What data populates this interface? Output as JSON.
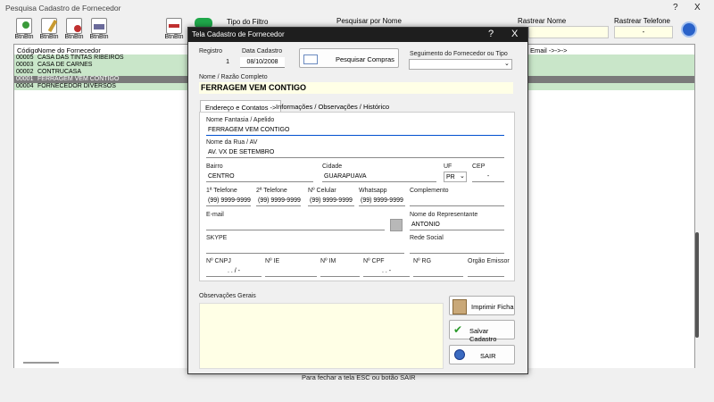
{
  "window": {
    "title": "Pesquisa Cadastro de Fornecedor",
    "help": "?",
    "close": "X"
  },
  "toolbar": {
    "buttons": [
      {
        "name": "new-button",
        "label": "BtnBtn",
        "color": "#3a9a3a"
      },
      {
        "name": "edit-button",
        "label": "BtnBtn",
        "color": "#c89a30"
      },
      {
        "name": "delete-button",
        "label": "BtnBtn",
        "color": "#c03030"
      },
      {
        "name": "print-button",
        "label": "BtnBtn",
        "color": "#6a6a9a"
      },
      {
        "name": "export-button",
        "label": "BtnBtn",
        "color": "#5a7ab0"
      }
    ],
    "filter_type_label": "Tipo do Filtro",
    "search_name_label": "Pesquisar por Nome",
    "track_name_label": "Rastrear Nome",
    "track_phone_label": "Rastrear Telefone",
    "track_phone_value": "-",
    "email_label": "Email ->->->"
  },
  "grid": {
    "headers": [
      "Código",
      "Nome do Fornecedor"
    ],
    "rows": [
      {
        "code": "00005",
        "name": "CASA DAS TINTAS RIBEIROS",
        "selected": false
      },
      {
        "code": "00003",
        "name": "CASA DE CARNES",
        "selected": false
      },
      {
        "code": "00002",
        "name": "CONTRUCASA",
        "selected": false
      },
      {
        "code": "00001",
        "name": "FERRAGEM VEM CONTIGO",
        "selected": true
      },
      {
        "code": "00004",
        "name": "FORNECEDOR DIVERSOS",
        "selected": false
      }
    ]
  },
  "status": {
    "text": "Para fechar a tela ESC ou botão SAIR"
  },
  "dialog": {
    "title": "Tela Cadastro de Fornecedor",
    "close": "X",
    "registro": {
      "label": "Registro",
      "value": "1"
    },
    "data_cadastro": {
      "label": "Data Cadastro",
      "value": "08/10/2008"
    },
    "pesquisar_compras": "Pesquisar Compras",
    "segmento": {
      "label": "Seguimento do Fornecedor ou Tipo",
      "value": ""
    },
    "razao": {
      "label": "Nome / Razão Completo",
      "value": "FERRAGEM VEM CONTIGO"
    },
    "tabs": [
      "Endereço e Contatos ->",
      "Informações / Observações / Histórico"
    ],
    "fantasia": {
      "label": "Nome Fantasia / Apelido",
      "value": "FERRAGEM VEM CONTIGO"
    },
    "rua": {
      "label": "Nome da Rua / AV",
      "value": "AV. VX DE SETEMBRO"
    },
    "bairro": {
      "label": "Bairro",
      "value": "CENTRO"
    },
    "cidade": {
      "label": "Cidade",
      "value": "GUARAPUAVA"
    },
    "uf": {
      "label": "UF",
      "value": "PR"
    },
    "cep": {
      "label": "CEP",
      "value": "-"
    },
    "tel1": {
      "label": "1ª Telefone",
      "value": "(99) 9999-9999"
    },
    "tel2": {
      "label": "2ª Telefone",
      "value": "(99) 9999-9999"
    },
    "celular": {
      "label": "Nº Celular",
      "value": "(99) 9999-9999"
    },
    "whatsapp": {
      "label": "Whatsapp",
      "value": "(99) 9999-9999"
    },
    "complemento": {
      "label": "Complemento",
      "value": ""
    },
    "email": {
      "label": "E-mail",
      "value": ""
    },
    "representante": {
      "label": "Nome do Representante",
      "value": "ANTONIO"
    },
    "skype": {
      "label": "SKYPE",
      "value": ""
    },
    "rede_social": {
      "label": "Rede Social",
      "value": ""
    },
    "cnpj": {
      "label": "Nº CNPJ",
      "value": ". . / -"
    },
    "ie": {
      "label": "Nº IE",
      "value": ""
    },
    "im": {
      "label": "Nº IM",
      "value": ""
    },
    "cpf": {
      "label": "Nº CPF",
      "value": ". . -"
    },
    "rg": {
      "label": "Nº RG",
      "value": ""
    },
    "orgao": {
      "label": "Orgão Emissor",
      "value": ""
    },
    "obs": {
      "label": "Observações Gerais",
      "value": ""
    },
    "buttons": {
      "imprimir": "Imprimir Ficha",
      "salvar": "Salvar Cadastro",
      "sair": "SAIR"
    }
  }
}
